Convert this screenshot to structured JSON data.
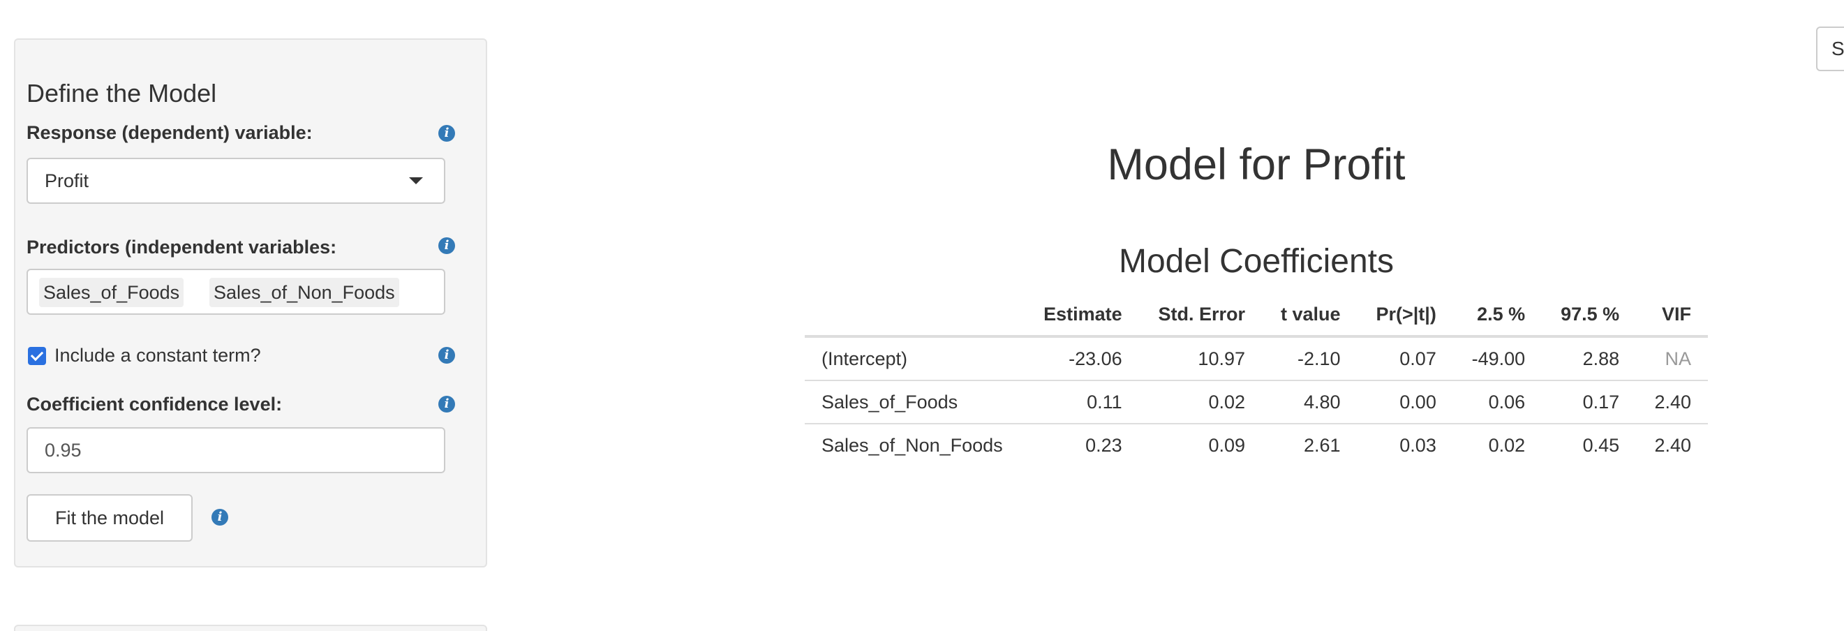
{
  "sidebar": {
    "title": "Define the Model",
    "response": {
      "label": "Response (dependent) variable:",
      "selected": "Profit"
    },
    "predictors": {
      "label": "Predictors (independent variables:",
      "tags": [
        "Sales_of_Foods",
        "Sales_of_Non_Foods"
      ]
    },
    "constant": {
      "label": "Include a constant term?",
      "checked": true
    },
    "confidence": {
      "label": "Coefficient confidence level:",
      "value": "0.95"
    },
    "fit_button": "Fit the model"
  },
  "top_right_button": "S",
  "main": {
    "title": "Model for Profit",
    "section_title": "Model Coefficients",
    "table": {
      "columns": [
        "",
        "Estimate",
        "Std. Error",
        "t value",
        "Pr(>|t|)",
        "2.5 %",
        "97.5 %",
        "VIF"
      ],
      "rows": [
        [
          "(Intercept)",
          "-23.06",
          "10.97",
          "-2.10",
          "0.07",
          "-49.00",
          "2.88",
          "NA"
        ],
        [
          "Sales_of_Foods",
          "0.11",
          "0.02",
          "4.80",
          "0.00",
          "0.06",
          "0.17",
          "2.40"
        ],
        [
          "Sales_of_Non_Foods",
          "0.23",
          "0.09",
          "2.61",
          "0.03",
          "0.02",
          "0.45",
          "2.40"
        ]
      ]
    }
  },
  "colors": {
    "accent": "#337ab7",
    "checkbox": "#2a70e0",
    "panel_bg": "#f5f5f5"
  },
  "icons": {
    "info": "info-icon",
    "dropdown": "chevron-down-icon",
    "check": "check-icon"
  }
}
